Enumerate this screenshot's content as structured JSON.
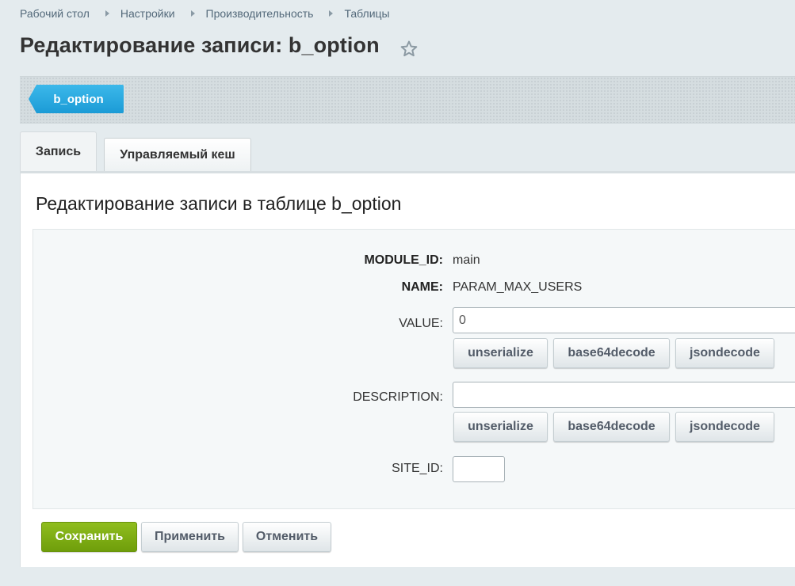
{
  "breadcrumbs": [
    "Рабочий стол",
    "Настройки",
    "Производительность",
    "Таблицы"
  ],
  "page": {
    "title": "Редактирование записи: b_option"
  },
  "context": {
    "tag_label": "b_option"
  },
  "tabs": [
    {
      "label": "Запись",
      "active": true
    },
    {
      "label": "Управляемый кеш",
      "active": false
    }
  ],
  "form": {
    "heading": "Редактирование записи в таблице b_option",
    "module_id": {
      "label": "MODULE_ID:",
      "value": "main"
    },
    "name": {
      "label": "NAME:",
      "value": "PARAM_MAX_USERS"
    },
    "value_field": {
      "label": "VALUE:",
      "value": "0"
    },
    "description_field": {
      "label": "DESCRIPTION:",
      "value": ""
    },
    "site_id_field": {
      "label": "SITE_ID:",
      "value": ""
    },
    "decode_buttons": [
      "unserialize",
      "base64decode",
      "jsondecode"
    ]
  },
  "actions": {
    "save": "Сохранить",
    "apply": "Применить",
    "cancel": "Отменить"
  },
  "colors": {
    "tag_blue": "#1b9bd6",
    "save_green": "#7aaa10",
    "page_background": "#e4ebee"
  },
  "icons": {
    "favorite": "star-icon",
    "breadcrumb_separator": "chevron-right-icon"
  }
}
